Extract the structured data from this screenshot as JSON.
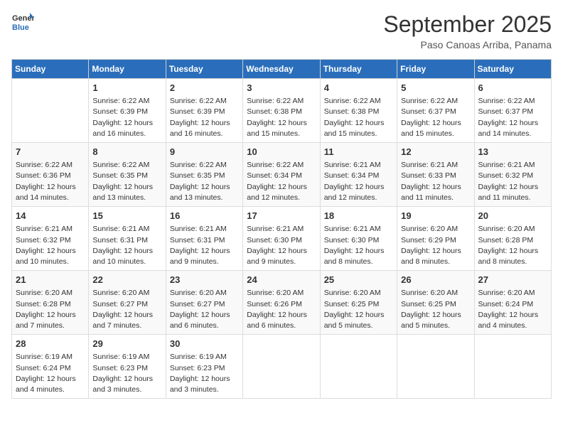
{
  "logo": {
    "line1": "General",
    "line2": "Blue"
  },
  "title": "September 2025",
  "location": "Paso Canoas Arriba, Panama",
  "days_of_week": [
    "Sunday",
    "Monday",
    "Tuesday",
    "Wednesday",
    "Thursday",
    "Friday",
    "Saturday"
  ],
  "weeks": [
    [
      {
        "day": "",
        "info": ""
      },
      {
        "day": "1",
        "info": "Sunrise: 6:22 AM\nSunset: 6:39 PM\nDaylight: 12 hours\nand 16 minutes."
      },
      {
        "day": "2",
        "info": "Sunrise: 6:22 AM\nSunset: 6:39 PM\nDaylight: 12 hours\nand 16 minutes."
      },
      {
        "day": "3",
        "info": "Sunrise: 6:22 AM\nSunset: 6:38 PM\nDaylight: 12 hours\nand 15 minutes."
      },
      {
        "day": "4",
        "info": "Sunrise: 6:22 AM\nSunset: 6:38 PM\nDaylight: 12 hours\nand 15 minutes."
      },
      {
        "day": "5",
        "info": "Sunrise: 6:22 AM\nSunset: 6:37 PM\nDaylight: 12 hours\nand 15 minutes."
      },
      {
        "day": "6",
        "info": "Sunrise: 6:22 AM\nSunset: 6:37 PM\nDaylight: 12 hours\nand 14 minutes."
      }
    ],
    [
      {
        "day": "7",
        "info": "Sunrise: 6:22 AM\nSunset: 6:36 PM\nDaylight: 12 hours\nand 14 minutes."
      },
      {
        "day": "8",
        "info": "Sunrise: 6:22 AM\nSunset: 6:35 PM\nDaylight: 12 hours\nand 13 minutes."
      },
      {
        "day": "9",
        "info": "Sunrise: 6:22 AM\nSunset: 6:35 PM\nDaylight: 12 hours\nand 13 minutes."
      },
      {
        "day": "10",
        "info": "Sunrise: 6:22 AM\nSunset: 6:34 PM\nDaylight: 12 hours\nand 12 minutes."
      },
      {
        "day": "11",
        "info": "Sunrise: 6:21 AM\nSunset: 6:34 PM\nDaylight: 12 hours\nand 12 minutes."
      },
      {
        "day": "12",
        "info": "Sunrise: 6:21 AM\nSunset: 6:33 PM\nDaylight: 12 hours\nand 11 minutes."
      },
      {
        "day": "13",
        "info": "Sunrise: 6:21 AM\nSunset: 6:32 PM\nDaylight: 12 hours\nand 11 minutes."
      }
    ],
    [
      {
        "day": "14",
        "info": "Sunrise: 6:21 AM\nSunset: 6:32 PM\nDaylight: 12 hours\nand 10 minutes."
      },
      {
        "day": "15",
        "info": "Sunrise: 6:21 AM\nSunset: 6:31 PM\nDaylight: 12 hours\nand 10 minutes."
      },
      {
        "day": "16",
        "info": "Sunrise: 6:21 AM\nSunset: 6:31 PM\nDaylight: 12 hours\nand 9 minutes."
      },
      {
        "day": "17",
        "info": "Sunrise: 6:21 AM\nSunset: 6:30 PM\nDaylight: 12 hours\nand 9 minutes."
      },
      {
        "day": "18",
        "info": "Sunrise: 6:21 AM\nSunset: 6:30 PM\nDaylight: 12 hours\nand 8 minutes."
      },
      {
        "day": "19",
        "info": "Sunrise: 6:20 AM\nSunset: 6:29 PM\nDaylight: 12 hours\nand 8 minutes."
      },
      {
        "day": "20",
        "info": "Sunrise: 6:20 AM\nSunset: 6:28 PM\nDaylight: 12 hours\nand 8 minutes."
      }
    ],
    [
      {
        "day": "21",
        "info": "Sunrise: 6:20 AM\nSunset: 6:28 PM\nDaylight: 12 hours\nand 7 minutes."
      },
      {
        "day": "22",
        "info": "Sunrise: 6:20 AM\nSunset: 6:27 PM\nDaylight: 12 hours\nand 7 minutes."
      },
      {
        "day": "23",
        "info": "Sunrise: 6:20 AM\nSunset: 6:27 PM\nDaylight: 12 hours\nand 6 minutes."
      },
      {
        "day": "24",
        "info": "Sunrise: 6:20 AM\nSunset: 6:26 PM\nDaylight: 12 hours\nand 6 minutes."
      },
      {
        "day": "25",
        "info": "Sunrise: 6:20 AM\nSunset: 6:25 PM\nDaylight: 12 hours\nand 5 minutes."
      },
      {
        "day": "26",
        "info": "Sunrise: 6:20 AM\nSunset: 6:25 PM\nDaylight: 12 hours\nand 5 minutes."
      },
      {
        "day": "27",
        "info": "Sunrise: 6:20 AM\nSunset: 6:24 PM\nDaylight: 12 hours\nand 4 minutes."
      }
    ],
    [
      {
        "day": "28",
        "info": "Sunrise: 6:19 AM\nSunset: 6:24 PM\nDaylight: 12 hours\nand 4 minutes."
      },
      {
        "day": "29",
        "info": "Sunrise: 6:19 AM\nSunset: 6:23 PM\nDaylight: 12 hours\nand 3 minutes."
      },
      {
        "day": "30",
        "info": "Sunrise: 6:19 AM\nSunset: 6:23 PM\nDaylight: 12 hours\nand 3 minutes."
      },
      {
        "day": "",
        "info": ""
      },
      {
        "day": "",
        "info": ""
      },
      {
        "day": "",
        "info": ""
      },
      {
        "day": "",
        "info": ""
      }
    ]
  ]
}
